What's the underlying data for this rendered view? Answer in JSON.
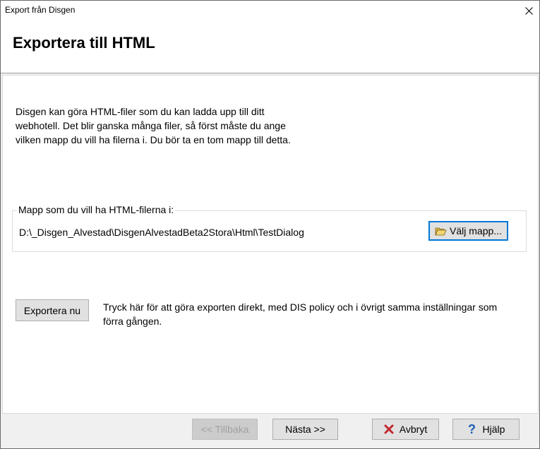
{
  "window": {
    "title": "Export från Disgen"
  },
  "header": {
    "title": "Exportera till HTML"
  },
  "intro": {
    "text": "Disgen kan göra HTML-filer som du kan ladda upp till ditt\nwebhotell. Det blir ganska många filer, så först måste du ange\nvilken mapp du vill ha filerna i. Du bör ta en tom mapp till detta."
  },
  "folder_group": {
    "label": "Mapp som du vill ha HTML-filerna i:",
    "path": "D:\\_Disgen_Alvestad\\DisgenAlvestadBeta2Stora\\Html\\TestDialog",
    "choose_button_label": "Välj mapp...",
    "choose_button_icon": "open-folder-icon"
  },
  "export_now": {
    "button_label": "Exportera nu",
    "description": "Tryck här för att göra exporten direkt, med DIS policy och i övrigt samma inställningar som förra gången."
  },
  "footer": {
    "back_label": "<< Tillbaka",
    "next_label": "Nästa >>",
    "cancel_label": "Avbryt",
    "cancel_icon": "red-x-icon",
    "help_label": "Hjälp",
    "help_icon": "question-mark-icon"
  },
  "colors": {
    "focus_border": "#0078d7",
    "cancel_icon": "#c0282d",
    "help_icon": "#1a5fb4"
  }
}
